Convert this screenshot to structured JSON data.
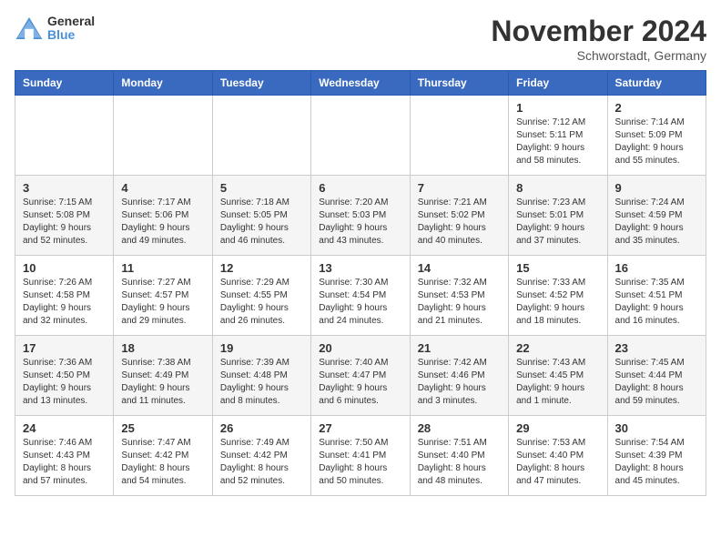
{
  "header": {
    "logo_general": "General",
    "logo_blue": "Blue",
    "month_title": "November 2024",
    "location": "Schworstadt, Germany"
  },
  "days_of_week": [
    "Sunday",
    "Monday",
    "Tuesday",
    "Wednesday",
    "Thursday",
    "Friday",
    "Saturday"
  ],
  "weeks": [
    [
      {
        "day": "",
        "info": ""
      },
      {
        "day": "",
        "info": ""
      },
      {
        "day": "",
        "info": ""
      },
      {
        "day": "",
        "info": ""
      },
      {
        "day": "",
        "info": ""
      },
      {
        "day": "1",
        "info": "Sunrise: 7:12 AM\nSunset: 5:11 PM\nDaylight: 9 hours and 58 minutes."
      },
      {
        "day": "2",
        "info": "Sunrise: 7:14 AM\nSunset: 5:09 PM\nDaylight: 9 hours and 55 minutes."
      }
    ],
    [
      {
        "day": "3",
        "info": "Sunrise: 7:15 AM\nSunset: 5:08 PM\nDaylight: 9 hours and 52 minutes."
      },
      {
        "day": "4",
        "info": "Sunrise: 7:17 AM\nSunset: 5:06 PM\nDaylight: 9 hours and 49 minutes."
      },
      {
        "day": "5",
        "info": "Sunrise: 7:18 AM\nSunset: 5:05 PM\nDaylight: 9 hours and 46 minutes."
      },
      {
        "day": "6",
        "info": "Sunrise: 7:20 AM\nSunset: 5:03 PM\nDaylight: 9 hours and 43 minutes."
      },
      {
        "day": "7",
        "info": "Sunrise: 7:21 AM\nSunset: 5:02 PM\nDaylight: 9 hours and 40 minutes."
      },
      {
        "day": "8",
        "info": "Sunrise: 7:23 AM\nSunset: 5:01 PM\nDaylight: 9 hours and 37 minutes."
      },
      {
        "day": "9",
        "info": "Sunrise: 7:24 AM\nSunset: 4:59 PM\nDaylight: 9 hours and 35 minutes."
      }
    ],
    [
      {
        "day": "10",
        "info": "Sunrise: 7:26 AM\nSunset: 4:58 PM\nDaylight: 9 hours and 32 minutes."
      },
      {
        "day": "11",
        "info": "Sunrise: 7:27 AM\nSunset: 4:57 PM\nDaylight: 9 hours and 29 minutes."
      },
      {
        "day": "12",
        "info": "Sunrise: 7:29 AM\nSunset: 4:55 PM\nDaylight: 9 hours and 26 minutes."
      },
      {
        "day": "13",
        "info": "Sunrise: 7:30 AM\nSunset: 4:54 PM\nDaylight: 9 hours and 24 minutes."
      },
      {
        "day": "14",
        "info": "Sunrise: 7:32 AM\nSunset: 4:53 PM\nDaylight: 9 hours and 21 minutes."
      },
      {
        "day": "15",
        "info": "Sunrise: 7:33 AM\nSunset: 4:52 PM\nDaylight: 9 hours and 18 minutes."
      },
      {
        "day": "16",
        "info": "Sunrise: 7:35 AM\nSunset: 4:51 PM\nDaylight: 9 hours and 16 minutes."
      }
    ],
    [
      {
        "day": "17",
        "info": "Sunrise: 7:36 AM\nSunset: 4:50 PM\nDaylight: 9 hours and 13 minutes."
      },
      {
        "day": "18",
        "info": "Sunrise: 7:38 AM\nSunset: 4:49 PM\nDaylight: 9 hours and 11 minutes."
      },
      {
        "day": "19",
        "info": "Sunrise: 7:39 AM\nSunset: 4:48 PM\nDaylight: 9 hours and 8 minutes."
      },
      {
        "day": "20",
        "info": "Sunrise: 7:40 AM\nSunset: 4:47 PM\nDaylight: 9 hours and 6 minutes."
      },
      {
        "day": "21",
        "info": "Sunrise: 7:42 AM\nSunset: 4:46 PM\nDaylight: 9 hours and 3 minutes."
      },
      {
        "day": "22",
        "info": "Sunrise: 7:43 AM\nSunset: 4:45 PM\nDaylight: 9 hours and 1 minute."
      },
      {
        "day": "23",
        "info": "Sunrise: 7:45 AM\nSunset: 4:44 PM\nDaylight: 8 hours and 59 minutes."
      }
    ],
    [
      {
        "day": "24",
        "info": "Sunrise: 7:46 AM\nSunset: 4:43 PM\nDaylight: 8 hours and 57 minutes."
      },
      {
        "day": "25",
        "info": "Sunrise: 7:47 AM\nSunset: 4:42 PM\nDaylight: 8 hours and 54 minutes."
      },
      {
        "day": "26",
        "info": "Sunrise: 7:49 AM\nSunset: 4:42 PM\nDaylight: 8 hours and 52 minutes."
      },
      {
        "day": "27",
        "info": "Sunrise: 7:50 AM\nSunset: 4:41 PM\nDaylight: 8 hours and 50 minutes."
      },
      {
        "day": "28",
        "info": "Sunrise: 7:51 AM\nSunset: 4:40 PM\nDaylight: 8 hours and 48 minutes."
      },
      {
        "day": "29",
        "info": "Sunrise: 7:53 AM\nSunset: 4:40 PM\nDaylight: 8 hours and 47 minutes."
      },
      {
        "day": "30",
        "info": "Sunrise: 7:54 AM\nSunset: 4:39 PM\nDaylight: 8 hours and 45 minutes."
      }
    ]
  ]
}
